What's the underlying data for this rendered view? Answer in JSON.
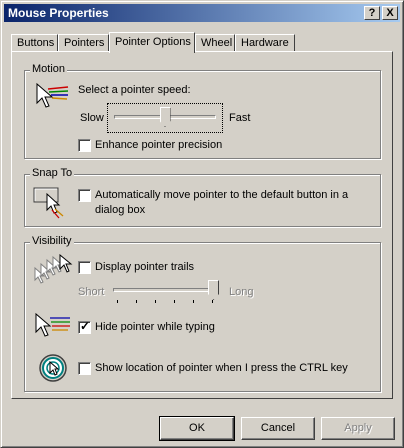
{
  "window": {
    "title": "Mouse Properties",
    "help_label": "?",
    "close_label": "X"
  },
  "tabs": [
    {
      "label": "Buttons",
      "active": false
    },
    {
      "label": "Pointers",
      "active": false
    },
    {
      "label": "Pointer Options",
      "active": true
    },
    {
      "label": "Wheel",
      "active": false
    },
    {
      "label": "Hardware",
      "active": false
    }
  ],
  "motion": {
    "group_label": "Motion",
    "speed_label": "Select a pointer speed:",
    "slow_label": "Slow",
    "fast_label": "Fast",
    "speed_level": 0.5,
    "precision_label": "Enhance pointer precision",
    "precision_checked": false,
    "icon": "pointer-speed-icon"
  },
  "snap": {
    "group_label": "Snap To",
    "label_line1": "Automatically move pointer to the default button in a",
    "label_line2": "dialog box",
    "checked": false,
    "icon": "snap-to-icon"
  },
  "visibility": {
    "group_label": "Visibility",
    "trails_label": "Display pointer trails",
    "trails_checked": false,
    "short_label": "Short",
    "long_label": "Long",
    "trail_level": 1.0,
    "hide_label": "Hide pointer while typing",
    "hide_checked": true,
    "ctrl_label": "Show location of pointer when I press the CTRL key",
    "ctrl_checked": false,
    "icons": [
      "pointer-trails-icon",
      "hide-pointer-icon",
      "pointer-location-icon"
    ]
  },
  "buttons": {
    "ok": "OK",
    "cancel": "Cancel",
    "apply": "Apply"
  },
  "colors": {
    "titlebar_start": "#0a246a",
    "titlebar_end": "#a6caf0",
    "face": "#d4d0c8"
  }
}
